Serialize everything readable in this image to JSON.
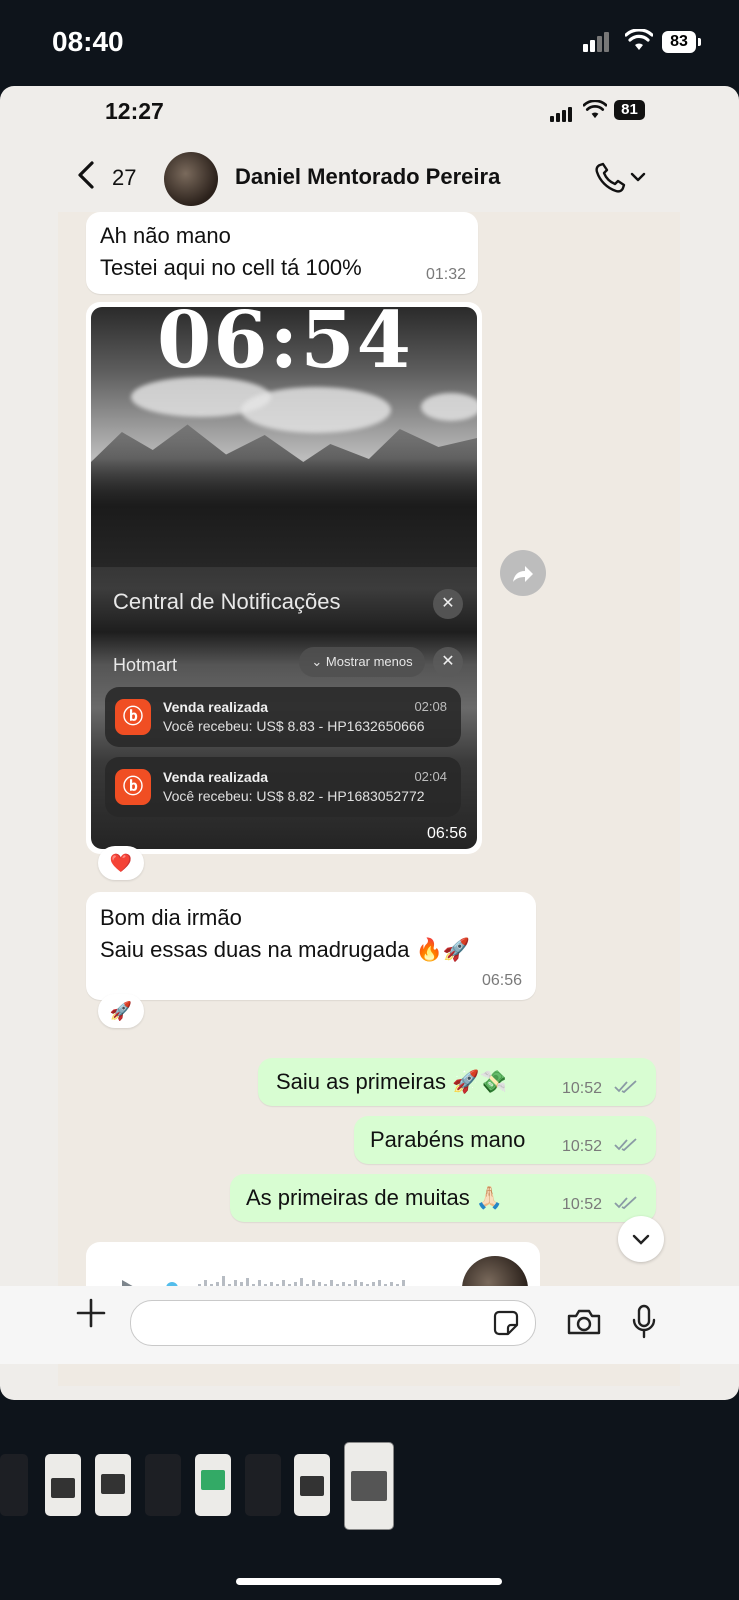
{
  "outer_status": {
    "time": "08:40",
    "battery": "83"
  },
  "inner_status": {
    "time": "12:27",
    "battery": "81"
  },
  "header": {
    "back_count": "27",
    "contact_name": "Daniel Mentorado Pereira"
  },
  "messages": {
    "m1": {
      "line1": "Ah não mano",
      "line2": "Testei aqui no cell tá 100%",
      "time": "01:32"
    },
    "image": {
      "clock": "06:54",
      "notification_center": "Central de Notificações",
      "app_group": "Hotmart",
      "show_less": "Mostrar menos",
      "notifications": [
        {
          "title": "Venda realizada",
          "body": "Você recebeu: US$ 8.83 - HP1632650666",
          "time": "02:08"
        },
        {
          "title": "Venda realizada",
          "body": "Você recebeu: US$ 8.82 - HP1683052772",
          "time": "02:04"
        }
      ],
      "time": "06:56",
      "reaction": "❤️"
    },
    "m2": {
      "line1": "Bom dia irmão",
      "line2": "Saiu essas duas na madrugada 🔥🚀",
      "time": "06:56",
      "reaction": "🚀"
    },
    "out1": {
      "text": "Saiu as primeiras 🚀💸",
      "time": "10:52"
    },
    "out2": {
      "text": "Parabéns mano",
      "time": "10:52"
    },
    "out3": {
      "text": "As primeiras de muitas 🙏🏻",
      "time": "10:52"
    }
  },
  "icons": {
    "back": "chevron-left-icon",
    "call": "phone-icon",
    "forward": "forward-icon",
    "scroll": "chevron-down-icon",
    "attach": "plus-icon",
    "sticker": "sticker-icon",
    "camera": "camera-icon",
    "mic": "microphone-icon"
  },
  "colors": {
    "outgoing_bubble": "#d8fdd2",
    "incoming_bubble": "#ffffff",
    "chat_bg": "#efeae3",
    "read_ticks": "#53bdeb"
  }
}
